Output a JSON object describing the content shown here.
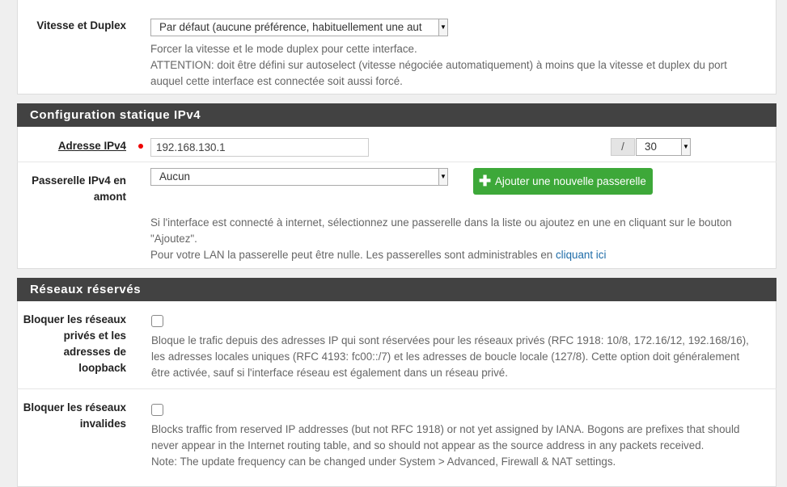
{
  "speed_duplex": {
    "label": "Vitesse et Duplex",
    "value": "Par défaut (aucune préférence, habituellement une aut",
    "help1": "Forcer la vitesse et le mode duplex pour cette interface.",
    "help2": "ATTENTION: doit être défini sur autoselect (vitesse négociée automatiquement) à moins que la vitesse et duplex du port",
    "help3": "auquel cette interface est connectée soit aussi forcé."
  },
  "ipv4_section": {
    "title": "Configuration statique IPv4",
    "address_label": "Adresse IPv4",
    "address_value": "192.168.130.1",
    "slash": "/",
    "cidr_value": "30",
    "gateway_label_line1": "Passerelle IPv4 en",
    "gateway_label_line2": "amont",
    "gateway_value": "Aucun",
    "add_gateway_button": "Ajouter une nouvelle passerelle",
    "help1": "Si l'interface est connecté à internet, sélectionnez une passerelle dans la liste ou ajoutez en une en cliquant sur le bouton",
    "help2": "\"Ajoutez\".",
    "help3": "Pour votre LAN la passerelle peut être nulle. Les passerelles sont administrables en ",
    "help_link": "cliquant ici"
  },
  "reserved_section": {
    "title": "Réseaux réservés",
    "private_label": [
      "Bloquer les réseaux",
      "privés et les",
      "adresses de",
      "loopback"
    ],
    "private_checked": false,
    "private_help1": "Bloque le trafic depuis des adresses IP qui sont réservées pour les réseaux privés (RFC 1918: 10/8, 172.16/12, 192.168/16),",
    "private_help2": "les adresses locales uniques (RFC 4193: fc00::/7) et les adresses de boucle locale (127/8). Cette option doit généralement",
    "private_help3": "être activée, sauf si l'interface réseau est également dans un réseau privé.",
    "bogon_label": [
      "Bloquer les réseaux",
      "invalides"
    ],
    "bogon_checked": false,
    "bogon_help1": "Blocks traffic from reserved IP addresses (but not RFC 1918) or not yet assigned by IANA. Bogons are prefixes that should",
    "bogon_help2": "never appear in the Internet routing table, and so should not appear as the source address in any packets received.",
    "bogon_help3": "Note: The update frequency can be changed under System > Advanced, Firewall & NAT settings."
  }
}
